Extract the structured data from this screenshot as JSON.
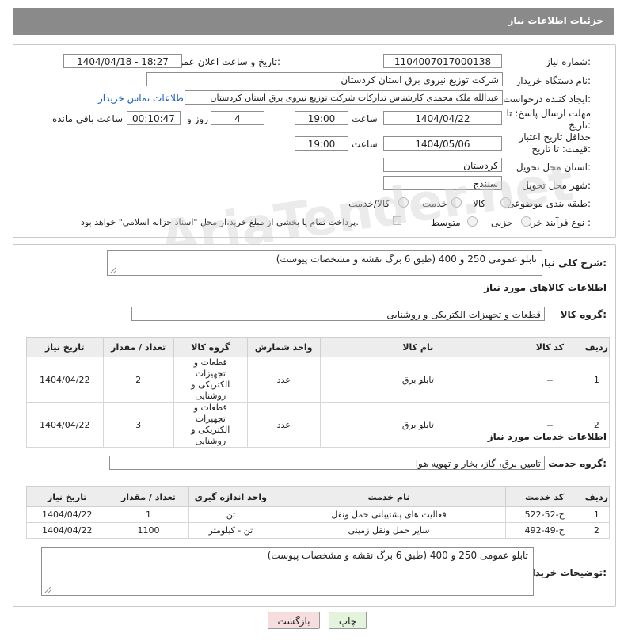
{
  "header": {
    "title": "جزئیات اطلاعات نیاز"
  },
  "fields": {
    "need_number_label": "شماره نیاز:",
    "need_number": "1104007017000138",
    "announce_label": "تاریخ و ساعت اعلان عمومی:",
    "announce_value": "1404/04/18 - 18:27",
    "buyer_label": "نام دستگاه خریدار:",
    "buyer_value": "شرکت توزیع نیروی برق استان کردستان",
    "creator_label": "ایجاد کننده درخواست:",
    "creator_value": "عبدالله ملک محمدی کارشناس تدارکات شرکت توزیع نیروی برق استان کردستان",
    "contact_link": "اطلاعات تماس خریدار",
    "deadline_label": "مهلت ارسال پاسخ: تا تاریخ:",
    "deadline_date": "1404/04/22",
    "time_label": "ساعت",
    "deadline_time": "19:00",
    "days_value": "4",
    "days_label": "روز و",
    "remaining_time": "00:10:47",
    "remaining_label": "ساعت باقی مانده",
    "validity_label": "حداقل تاریخ اعتبار قیمت: تا تاریخ:",
    "validity_date": "1404/05/06",
    "validity_time": "19:00",
    "province_label": "استان محل تحویل:",
    "province_value": "کردستان",
    "city_label": "شهر محل تحویل:",
    "city_value": "سنندج",
    "category_label": "طبقه بندی موضوعی:",
    "category_options": [
      "کالا",
      "خدمت",
      "کالا/خدمت"
    ],
    "process_label": "نوع فرآیند خرید :",
    "process_options": [
      "جزیی",
      "متوسط"
    ],
    "payment_note": "پرداخت تمام یا بخشی از مبلغ خرید،از محل \"اسناد خزانه اسلامی\" خواهد بود."
  },
  "summary": {
    "label": "شرح کلی نیاز:",
    "value": "تابلو عمومی 250 و 400 (طبق 6 برگ نقشه و مشخصات پیوست)"
  },
  "goods": {
    "section_title": "اطلاعات کالاهای مورد نیاز",
    "group_label": "گروه کالا:",
    "group_value": "قطعات و تجهیزات الکتریکی و روشنایی",
    "columns": [
      "ردیف",
      "کد کالا",
      "نام کالا",
      "واحد شمارش",
      "گروه کالا",
      "تعداد / مقدار",
      "تاریخ نیاز"
    ],
    "rows": [
      {
        "row": "1",
        "code": "--",
        "name": "تابلو برق",
        "unit": "عدد",
        "group": "قطعات و تجهیزات الکتریکی و روشنایی",
        "qty": "2",
        "date": "1404/04/22"
      },
      {
        "row": "2",
        "code": "--",
        "name": "تابلو برق",
        "unit": "عدد",
        "group": "قطعات و تجهیزات الکتریکی و روشنایی",
        "qty": "3",
        "date": "1404/04/22"
      }
    ]
  },
  "services": {
    "section_title": "اطلاعات خدمات مورد نیاز",
    "group_label": "گروه خدمت:",
    "group_value": "تامین برق، گاز، بخار و تهویه هوا",
    "columns": [
      "ردیف",
      "کد خدمت",
      "نام خدمت",
      "واحد اندازه گیری",
      "تعداد / مقدار",
      "تاریخ نیاز"
    ],
    "rows": [
      {
        "row": "1",
        "code": "ح-52-522",
        "name": "فعالیت های پشتیبانی حمل ونقل",
        "unit": "تن",
        "qty": "1",
        "date": "1404/04/22"
      },
      {
        "row": "2",
        "code": "ح-49-492",
        "name": "سایر حمل ونقل زمینی",
        "unit": "تن - کیلومتر",
        "qty": "1100",
        "date": "1404/04/22"
      }
    ]
  },
  "buyer_notes": {
    "label": "توضیحات خریدار:",
    "value": "تابلو عمومی 250 و 400 (طبق 6 برگ نقشه و مشخصات پیوست)"
  },
  "buttons": {
    "print": "چاپ",
    "back": "بازگشت"
  },
  "colors": {
    "header_bg": "#8a8a8a",
    "link": "#1a5fb4",
    "back_button_bg": "#f6dede",
    "print_button_bg": "#e4f3dc"
  },
  "watermark": "AriaTender.net"
}
